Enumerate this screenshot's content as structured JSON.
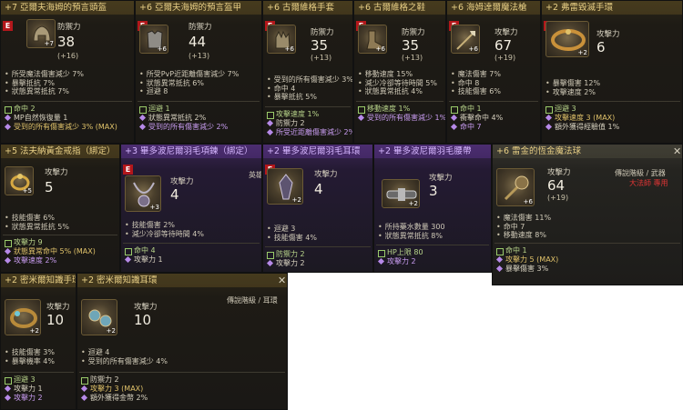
{
  "cards": {
    "c1": {
      "name": "+7 亞爾夫海姆的預言頭盔",
      "grade": "E",
      "stat_label": "防禦力",
      "stat_value": "38",
      "stat_sub": "(+16)",
      "icon_plus": "+7",
      "stats": [
        "所受魔法傷害減少 7%",
        "暴擊抵抗 7%",
        "狀態異常抵抗 7%"
      ],
      "extra": [
        "命中 2",
        "MP自然恢復量 1",
        "受到的所有傷害減少 3% (MAX)"
      ]
    },
    "c2": {
      "name": "+6 亞爾夫海姆的預言盔甲",
      "grade": "E",
      "stat_label": "防禦力",
      "stat_value": "44",
      "stat_sub": "(+13)",
      "icon_plus": "+6",
      "stats": [
        "所受PvP近距離傷害減少 7%",
        "狀態異常抵抗 6%",
        "迴避 8"
      ],
      "extra": [
        "迴避 1",
        "狀態異常抵抗 2%",
        "受到的所有傷害減少 2%"
      ]
    },
    "c3": {
      "name": "+6 古爾維格手套",
      "grade": "E",
      "stat_label": "防禦力",
      "stat_value": "35",
      "stat_sub": "(+13)",
      "icon_plus": "+6",
      "stats": [
        "受到的所有傷害減少 3%",
        "命中 4",
        "暴擊抵抗 5%"
      ],
      "extra": [
        "攻擊速度 1%",
        "防禦力 2",
        "所受近距離傷害減少 2%"
      ]
    },
    "c4": {
      "name": "+6 古爾維格之鞋",
      "grade": "E",
      "stat_label": "防禦力",
      "stat_value": "35",
      "stat_sub": "(+13)",
      "icon_plus": "+6",
      "stats": [
        "移動速度 15%",
        "減少冷卻等待時間 5%",
        "狀態異常抵抗 4%"
      ],
      "extra": [
        "移動速度 1%",
        "受到的所有傷害減少 1%"
      ]
    },
    "c5": {
      "name": "+6 海姆達爾魔法槍",
      "grade": "E",
      "stat_label": "攻擊力",
      "stat_value": "67",
      "stat_sub": "(+19)",
      "icon_plus": "+6",
      "stats": [
        "魔法傷害 7%",
        "命中 8",
        "技能傷害 6%"
      ],
      "extra": [
        "命中 1",
        "衝擊命中 4%",
        "命中 7"
      ]
    },
    "c6": {
      "name": "+2 弗雷毀滅手環",
      "grade": "E",
      "stat_label": "攻擊力",
      "stat_value": "6",
      "stat_sub": "",
      "icon_plus": "+2",
      "stats": [
        "暴擊傷害 12%",
        "攻擊速度 2%"
      ],
      "extra": [
        "迴避 3",
        "攻擊速度 3 (MAX)",
        "額外獲得經驗值 1%"
      ]
    },
    "c7": {
      "name": "+5 法夫納黃金戒指（綁定）",
      "grade": "E",
      "stat_label": "攻擊力",
      "stat_value": "5",
      "stat_sub": "",
      "icon_plus": "+5",
      "stats": [
        "技能傷害 6%",
        "狀態異常抵抗 5%"
      ],
      "extra": [
        "攻擊力 9",
        "狀態異常命中 5% (MAX)",
        "攻擊速度 2%"
      ]
    },
    "c8": {
      "name": "+3 畢多波尼爾羽毛項鍊（綁定）",
      "grade": "E",
      "stat_label": "攻擊力",
      "stat_value": "4",
      "stat_sub": "",
      "icon_plus": "+3",
      "tag": "英雄",
      "stats": [
        "技能傷害 2%",
        "減少冷卻等待時間 4%"
      ],
      "extra": [
        "命中 4",
        "攻擊力 1"
      ]
    },
    "c9": {
      "name": "+2 畢多波尼爾羽毛耳環",
      "grade": "E",
      "stat_label": "攻擊力",
      "stat_value": "4",
      "stat_sub": "",
      "icon_plus": "+2",
      "stats": [
        "迴避 3",
        "技能傷害 4%"
      ],
      "extra": [
        "防禦力 2",
        "攻擊力 2"
      ]
    },
    "c10": {
      "name": "+2 畢多波尼爾羽毛腰帶",
      "grade": "E",
      "stat_label": "攻擊力",
      "stat_value": "3",
      "stat_sub": "",
      "icon_plus": "+2",
      "stats": [
        "所持藥水數量 300",
        "狀態異常抵抗 8%"
      ],
      "extra": [
        "HP上限 80",
        "攻擊力 2"
      ]
    },
    "c11": {
      "name": "+6 雷金的恆金魔法球",
      "grade": "E",
      "stat_label": "攻擊力",
      "stat_value": "64",
      "stat_sub": "(+19)",
      "icon_plus": "+6",
      "tag": "傳說階級 / 武器",
      "tag2": "大法師 專用",
      "stats": [
        "魔法傷害 11%",
        "命中 7",
        "移動速度 8%"
      ],
      "extra": [
        "命中 1",
        "攻擊力 5 (MAX)",
        "暴擊傷害 3%"
      ]
    },
    "c12": {
      "name": "+2 密米爾知識手環",
      "grade": "E",
      "stat_label": "攻擊力",
      "stat_value": "10",
      "stat_sub": "",
      "icon_plus": "+2",
      "stats": [
        "技能傷害 3%",
        "暴擊機率 4%"
      ],
      "extra": [
        "迴避 3",
        "攻擊力 1",
        "攻擊力 2"
      ]
    },
    "c13": {
      "name": "+2 密米爾知識耳環",
      "grade": "E",
      "stat_label": "攻擊力",
      "stat_value": "10",
      "stat_sub": "",
      "icon_plus": "+2",
      "tag": "傳說階級 / 耳環",
      "stats": [
        "迴避 4",
        "受到的所有傷害減少 4%"
      ],
      "extra": [
        "防禦力 2",
        "攻擊力 3 (MAX)",
        "額外獲得金幣 2%"
      ]
    }
  },
  "close_glyph": "✕",
  "colors": {
    "grade_badge": "#b3171b",
    "legend_header": "#e8cf85",
    "hero_header": "#d6b6ff",
    "add_green": "#b8d48a",
    "add_purple": "#c89cf0",
    "add_yellow": "#e0c26a"
  }
}
